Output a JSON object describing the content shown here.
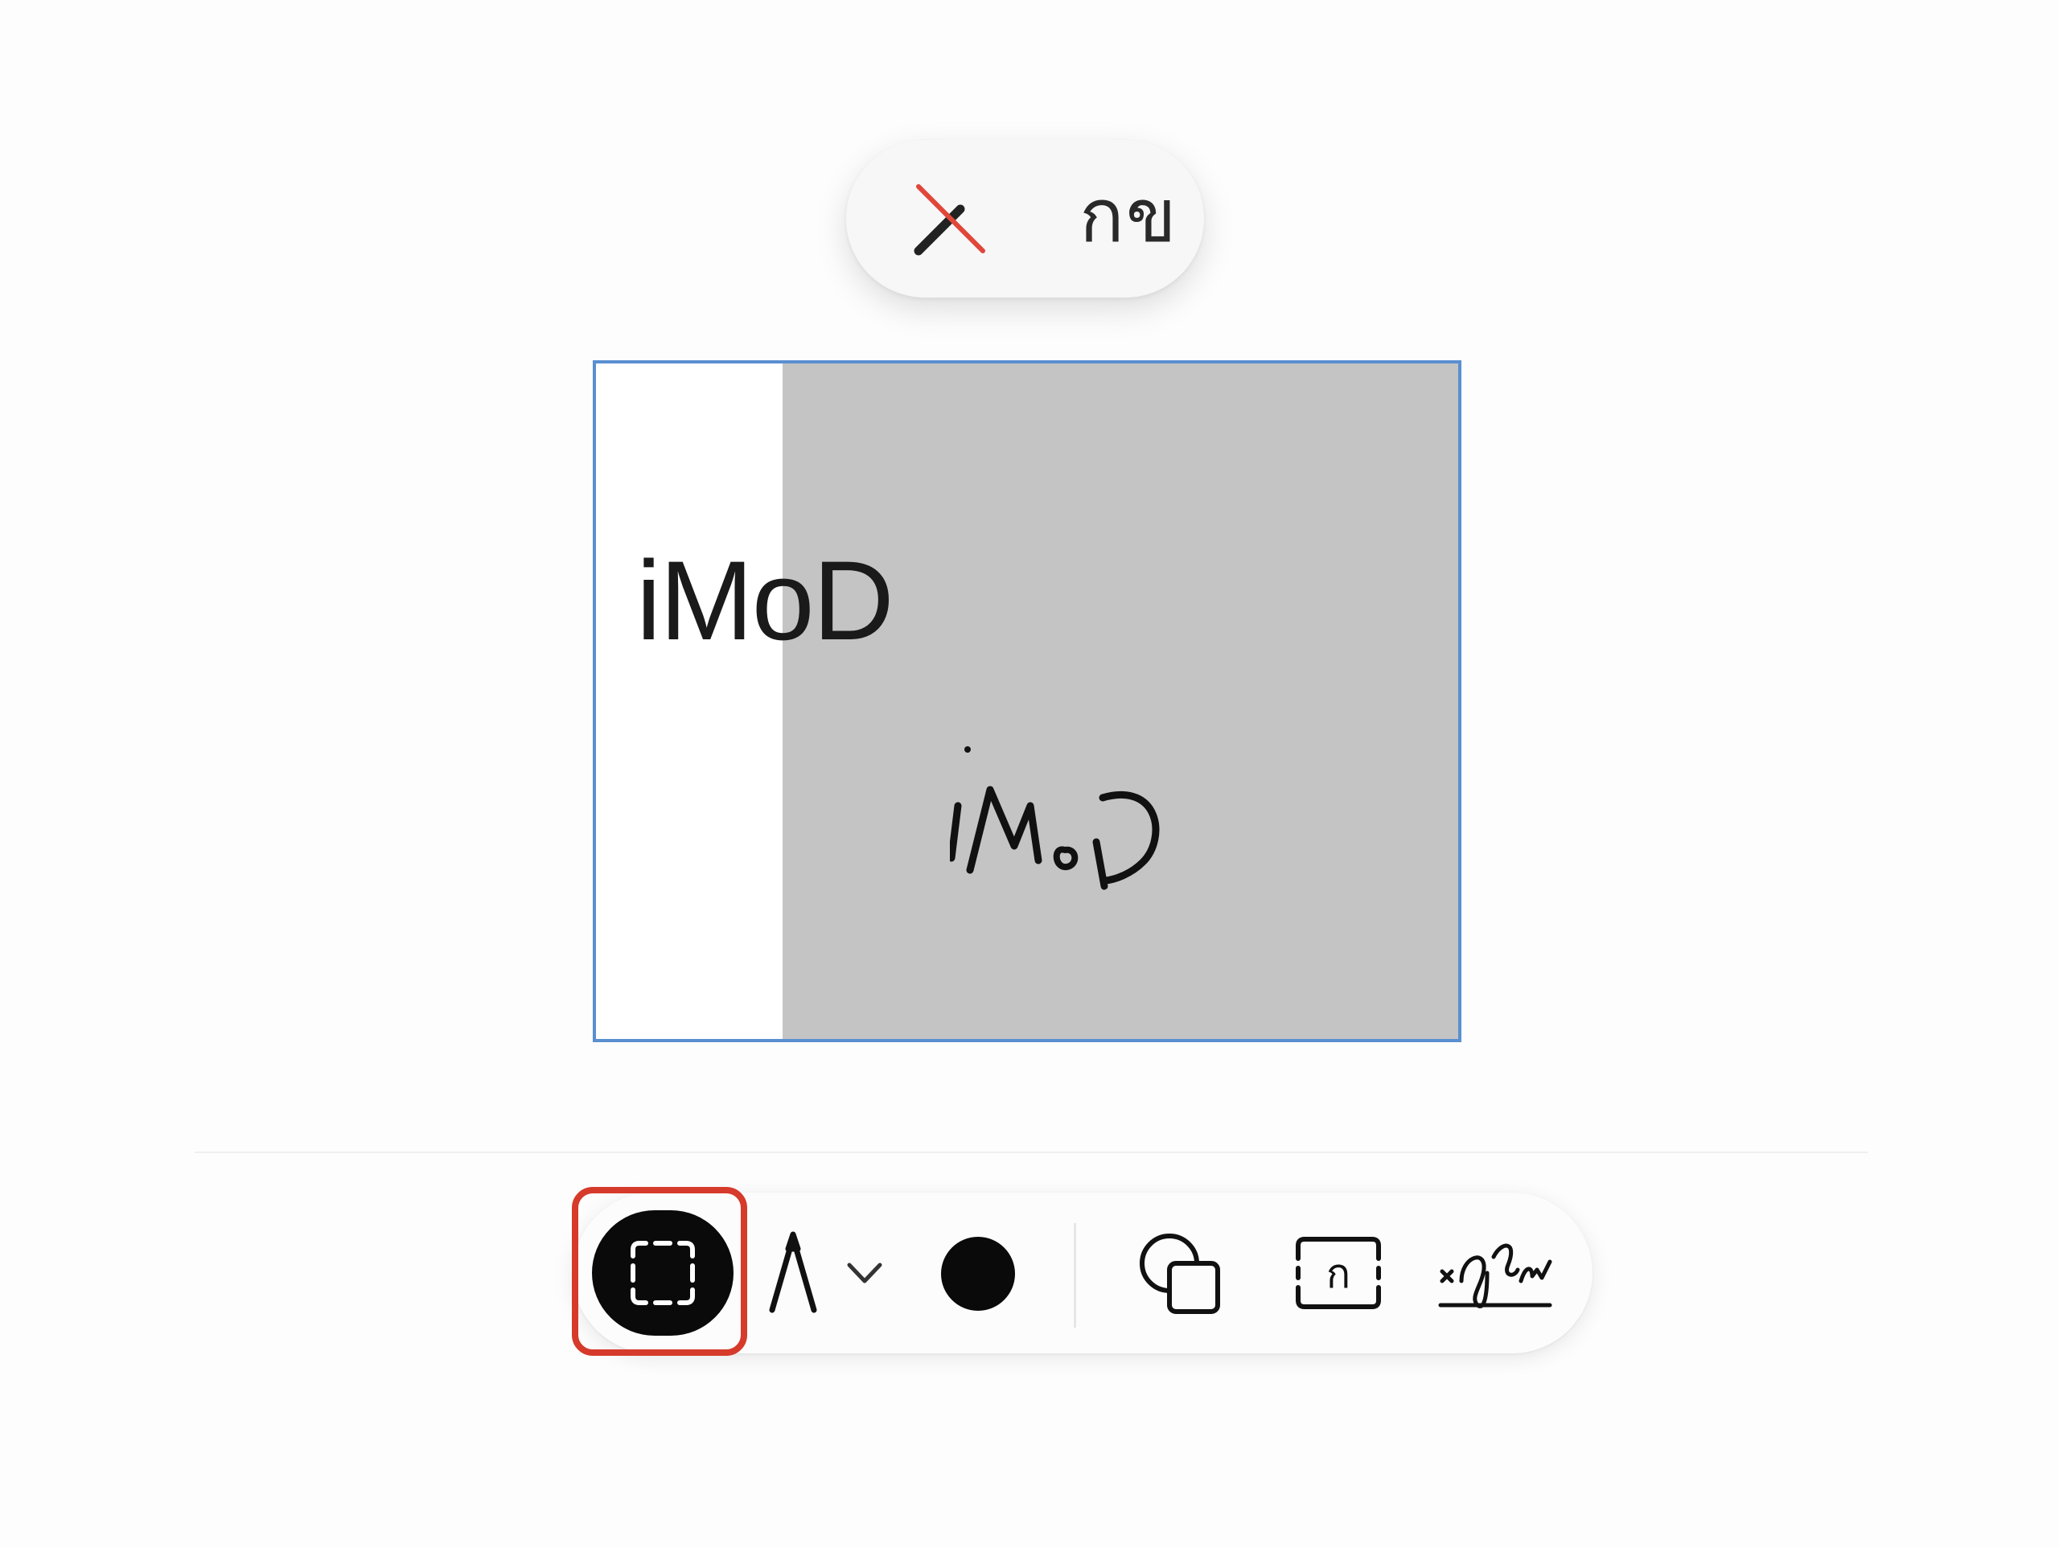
{
  "top_bar": {
    "close_label": "×",
    "keyboard_label": "กข"
  },
  "canvas": {
    "typed_text": "iMoD",
    "handwritten_text": "iMoD"
  },
  "toolbar": {
    "tools": [
      "select-tool",
      "pen-tool",
      "tool-options",
      "color",
      "shapes-tool",
      "text-box-tool",
      "signature-tool"
    ],
    "selected_tool": "select-tool",
    "active_color": "#000000",
    "text_box_glyph": "ก",
    "signature_glyphs": "×ญ่น่า"
  },
  "colors": {
    "highlight": "#d63a2b",
    "canvas_border": "#5a8fd0",
    "gray_fill": "#c4c4c4",
    "close_red": "#e0463a"
  }
}
